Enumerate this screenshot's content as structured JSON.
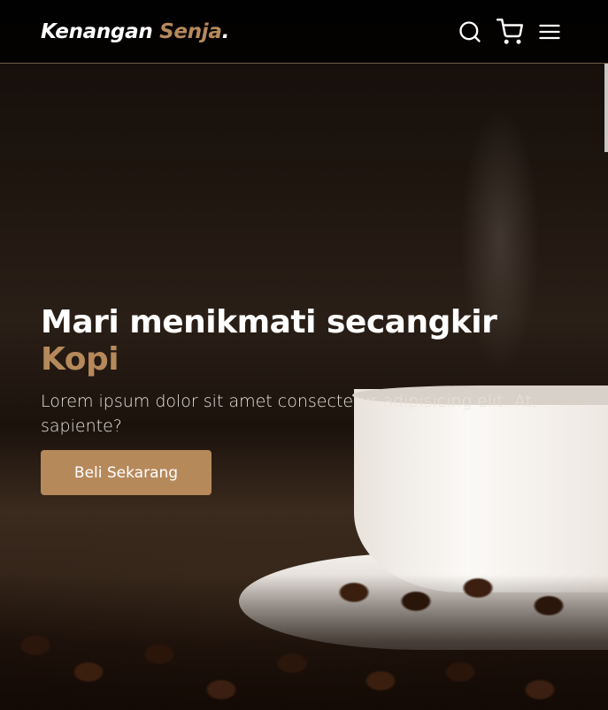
{
  "brand": {
    "name": "Kenangan",
    "accent": "Senja",
    "dot": ".",
    "accent_color": "#b6895b"
  },
  "nav": {
    "icons": [
      "search-icon",
      "cart-icon",
      "menu-icon"
    ]
  },
  "hero": {
    "title": "Mari menikmati secangkir",
    "title_accent": "Kopi",
    "description": "Lorem ipsum dolor sit amet consectetur adipisicing elit. At, sapiente?",
    "cta_label": "Beli Sekarang"
  }
}
